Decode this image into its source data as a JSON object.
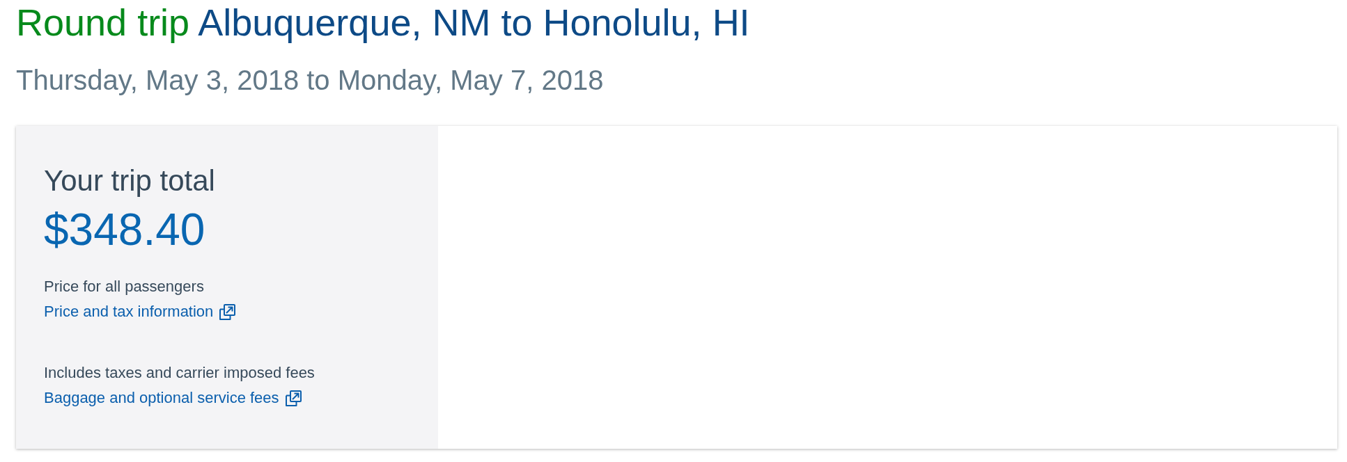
{
  "header": {
    "trip_type": "Round trip",
    "route": "Albuquerque, NM to Honolulu, HI",
    "dates": "Thursday, May 3, 2018 to Monday, May 7, 2018"
  },
  "summary": {
    "heading": "Your trip total",
    "total": "$348.40",
    "sections": [
      {
        "note": "Price for all passengers",
        "link": "Price and tax information"
      },
      {
        "note": "Includes taxes and carrier imposed fees",
        "link": "Baggage and optional service fees"
      }
    ]
  }
}
